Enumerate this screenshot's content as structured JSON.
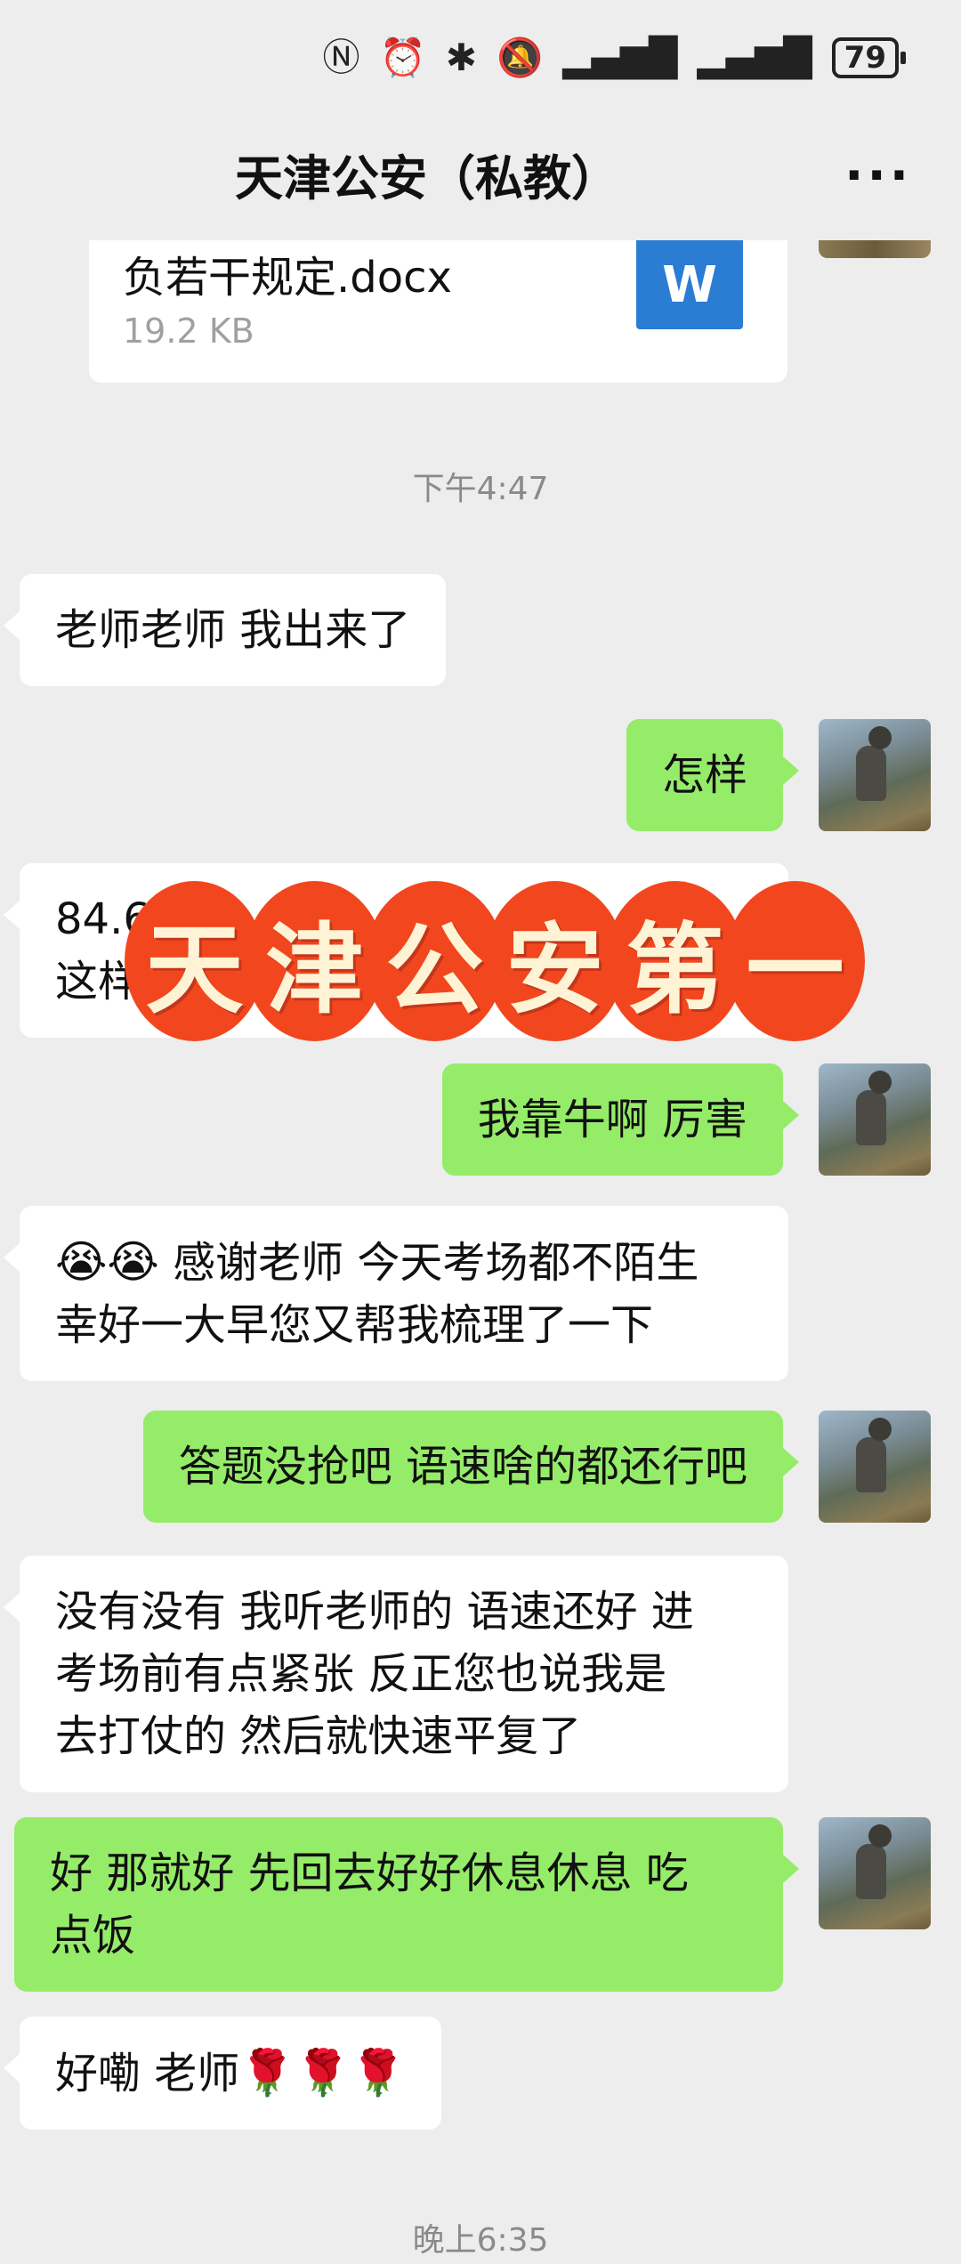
{
  "status_bar": {
    "icons": [
      "nfc-icon",
      "alarm-icon",
      "bluetooth-icon",
      "mute-icon",
      "signal-icon",
      "signal-icon"
    ],
    "battery": "79"
  },
  "header": {
    "title": "天津公安（私教）",
    "more_icon": "more-icon"
  },
  "file_message": {
    "name": "负若干规定.docx",
    "size": "19.2 KB",
    "icon_letter": "W"
  },
  "timestamps": [
    "下午4:47",
    "晚上6:35"
  ],
  "messages": [
    {
      "side": "left",
      "lines": [
        "老师老师 我出来了"
      ]
    },
    {
      "side": "right",
      "lines": [
        "怎样"
      ]
    },
    {
      "side": "left",
      "lines": [
        "84.6",
        "这样"
      ]
    },
    {
      "side": "right",
      "lines": [
        "我靠牛啊 厉害"
      ]
    },
    {
      "side": "left",
      "emoji": "😭😭",
      "lines": [
        " 感谢老师 今天考场都不陌生",
        "幸好一大早您又帮我梳理了一下"
      ]
    },
    {
      "side": "right",
      "lines": [
        "答题没抢吧 语速啥的都还行吧"
      ]
    },
    {
      "side": "left",
      "lines": [
        "没有没有 我听老师的 语速还好 进",
        "考场前有点紧张 反正您也说我是",
        "去打仗的 然后就快速平复了"
      ]
    },
    {
      "side": "right",
      "lines": [
        "好 那就好 先回去好好休息休息 吃",
        "点饭"
      ]
    },
    {
      "side": "left",
      "lines": [
        "好嘞 老师"
      ],
      "emoji_after": "🌹🌹🌹"
    }
  ],
  "banner": {
    "chars": [
      "天",
      "津",
      "公",
      "安",
      "第",
      "一"
    ],
    "color": "#f2471e"
  },
  "colors": {
    "bubble_self": "#95ec69",
    "bubble_other": "#ffffff",
    "background": "#ededed"
  }
}
